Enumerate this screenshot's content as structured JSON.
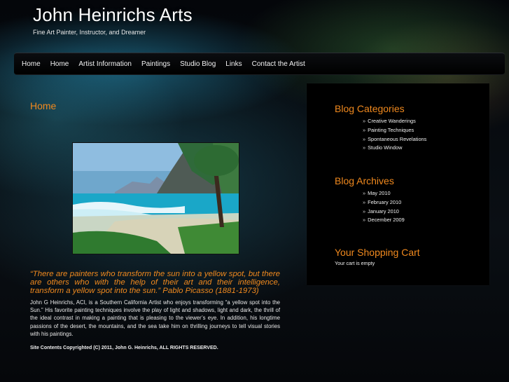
{
  "header": {
    "title": "John Heinrichs Arts",
    "tagline": "Fine Art Painter, Instructor, and Dreamer"
  },
  "nav": {
    "items": [
      {
        "label": "Home"
      },
      {
        "label": "Home"
      },
      {
        "label": "Artist Information"
      },
      {
        "label": "Paintings"
      },
      {
        "label": "Studio Blog"
      },
      {
        "label": "Links"
      },
      {
        "label": "Contact the Artist"
      }
    ]
  },
  "main": {
    "title": "Home",
    "quote": "“There are painters who transform the sun into a yellow spot, but there are others who with the help of their art and their intelligence, transform a yellow spot into the sun.” Pablo Picasso (1881-1973)",
    "body": "John G Heinrichs, ACI, is a Southern California Artist who enjoys transforming “a yellow spot into the Sun.”  His favorite painting techniques involve the play of light and shadows, light and dark, the thrill of the ideal contrast in making a painting that is pleasing to the viewer’s eye.  In addition, his longtime passions of the desert, the mountains, and the sea take him on thrilling journeys to tell visual stories with his paintings.",
    "copyright": "Site Contents Copyrighted (C) 2011, John G. Heinrichs, ALL RIGHTS RESERVED."
  },
  "sidebar": {
    "categories": {
      "heading": "Blog Categories",
      "items": [
        "Creative Wanderings",
        "Painting Techniques",
        "Spontaneous Revelations",
        "Studio Window"
      ]
    },
    "archives": {
      "heading": "Blog Archives",
      "items": [
        "May 2010",
        "February 2010",
        "January 2010",
        "December 2009"
      ]
    },
    "cart": {
      "heading": "Your Shopping Cart",
      "text": "Your cart is empty"
    },
    "bullet": "»"
  },
  "colors": {
    "accent": "#f0891e",
    "background": "#05070b"
  }
}
